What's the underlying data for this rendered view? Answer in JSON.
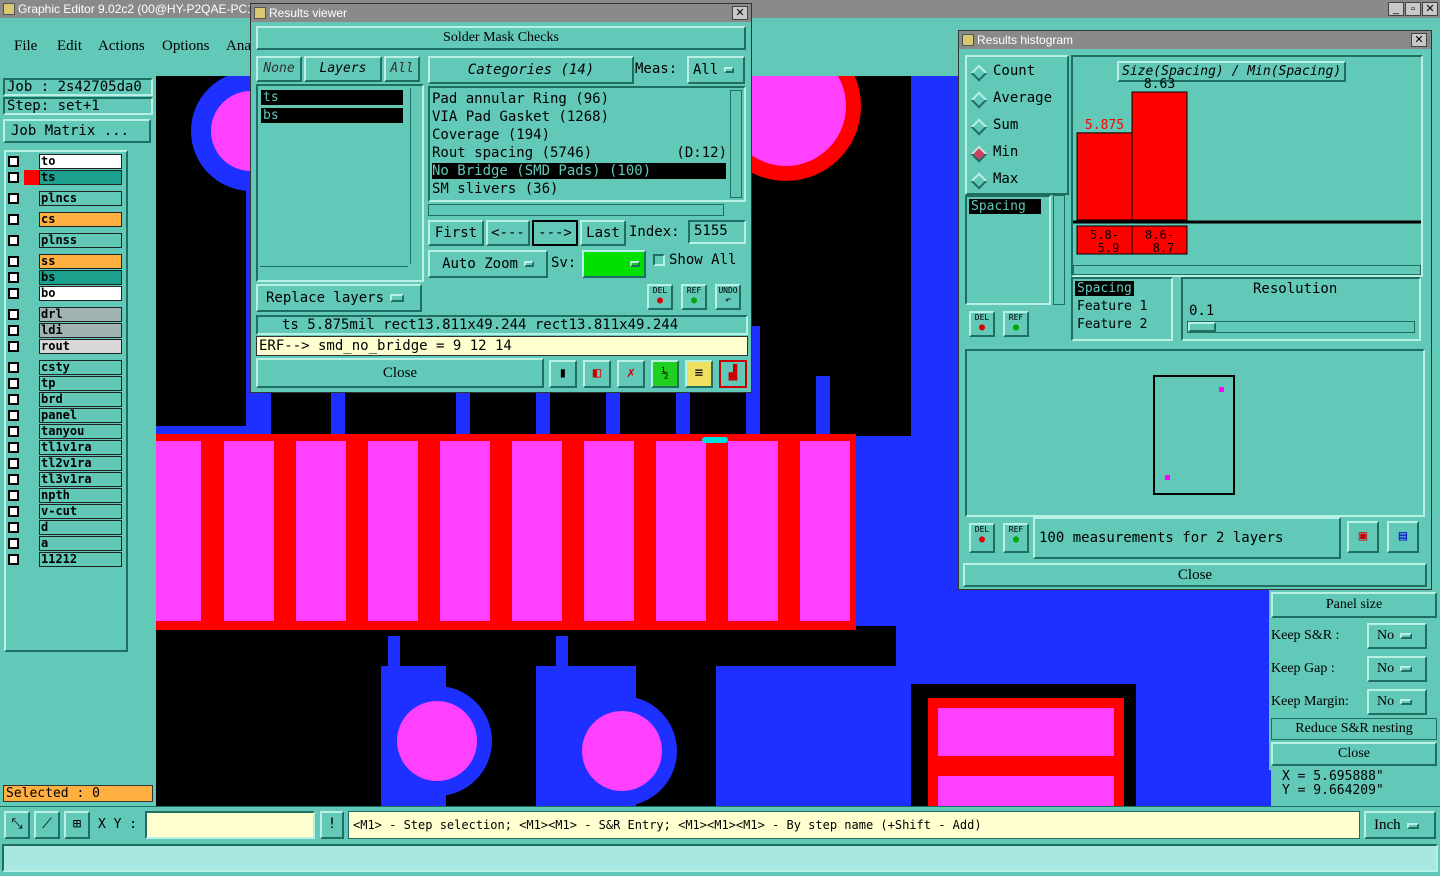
{
  "app": {
    "title": "Graphic Editor 9.02c2 (00@HY-P2QAE-PC1",
    "menu": [
      "File",
      "Edit",
      "Actions",
      "Options",
      "Ana"
    ]
  },
  "job": {
    "label": "Job : 2s42705da0",
    "step": "Step: set+1",
    "matrix_button": "Job Matrix ..."
  },
  "layers": [
    {
      "name": "to",
      "color": "#ffffff"
    },
    {
      "name": "ts",
      "color": "#1aa08c"
    },
    {
      "name": "plncs",
      "color": "#62c8b8"
    },
    {
      "name": "cs",
      "color": "#ffb040"
    },
    {
      "name": "plnss",
      "color": "#62c8b8"
    },
    {
      "name": "ss",
      "color": "#ffb040"
    },
    {
      "name": "bs",
      "color": "#1aa08c"
    },
    {
      "name": "bo",
      "color": "#ffffff"
    },
    {
      "name": "drl",
      "color": "#a0b4b4"
    },
    {
      "name": "ldi",
      "color": "#a0b4b4"
    },
    {
      "name": "rout",
      "color": "#d8d8d8"
    },
    {
      "name": "csty",
      "color": "#62c8b8"
    },
    {
      "name": "tp",
      "color": "#62c8b8"
    },
    {
      "name": "brd",
      "color": "#62c8b8"
    },
    {
      "name": "panel",
      "color": "#62c8b8"
    },
    {
      "name": "tanyou",
      "color": "#62c8b8"
    },
    {
      "name": "tl1v1ra",
      "color": "#62c8b8"
    },
    {
      "name": "tl2v1ra",
      "color": "#62c8b8"
    },
    {
      "name": "tl3v1ra",
      "color": "#62c8b8"
    },
    {
      "name": "npth",
      "color": "#62c8b8"
    },
    {
      "name": "v-cut",
      "color": "#62c8b8"
    },
    {
      "name": "d",
      "color": "#62c8b8"
    },
    {
      "name": "a",
      "color": "#62c8b8"
    },
    {
      "name": "11212",
      "color": "#62c8b8"
    }
  ],
  "selected": "Selected : 0",
  "results_viewer": {
    "title": "Results viewer",
    "header": "Solder Mask Checks",
    "none_btn": "None",
    "layers_btn": "Layers",
    "all_btn": "All",
    "layer_list": [
      "ts",
      "bs"
    ],
    "categories_btn": "Categories (14)",
    "meas_label": "Meas:",
    "meas_value": "All",
    "categories": [
      "Pad annular Ring (96)",
      "VIA Pad Gasket (1268)",
      "Coverage (194)",
      "Rout spacing (5746)          (D:12)",
      "No Bridge (SMD Pads) (100)",
      "SM slivers (36)"
    ],
    "first_btn": "First",
    "prev_btn": "<---",
    "next_btn": "--->",
    "last_btn": "Last",
    "index_label": "Index:",
    "index_value": "5155",
    "auto_zoom": "Auto Zoom",
    "sv_label": "Sv:",
    "show_all": "Show All",
    "replace_layers": "Replace layers",
    "del": "DEL",
    "ref": "REF",
    "undo": "UNDO",
    "status": "ts 5.875mil  rect13.811x49.244  rect13.811x49.244",
    "erf": "ERF--> smd_no_bridge = 9 12 14",
    "close": "Close"
  },
  "histogram": {
    "title": "Results histogram",
    "modes": [
      "Count",
      "Average",
      "Sum",
      "Min",
      "Max"
    ],
    "selected_mode": "Min",
    "chart_title": "Size(Spacing) / Min(Spacing)",
    "list_item": "Spacing",
    "feature_list": [
      "Spacing",
      "Feature 1",
      "Feature 2"
    ],
    "resolution_label": "Resolution",
    "resolution_value": "0.1",
    "measurements": "100 measurements for 2 layers",
    "close": "Close",
    "del": "DEL",
    "ref": "REF"
  },
  "chart_data": {
    "type": "bar",
    "title": "Size(Spacing) / Min(Spacing)",
    "categories": [
      "5.8-5.9",
      "8.6-8.7"
    ],
    "values": [
      5.875,
      8.63
    ],
    "value_labels": [
      "5.875",
      "8.63"
    ],
    "bin_labels": [
      [
        "5.8-",
        "5.9"
      ],
      [
        "8.6-",
        "8.7"
      ]
    ]
  },
  "panel": {
    "panel_size": "Panel size",
    "keep_sr_label": "Keep S&R  :",
    "keep_sr_value": "No",
    "keep_gap_label": "Keep Gap   :",
    "keep_gap_value": "No",
    "keep_margin_label": "Keep Margin:",
    "keep_margin_value": "No",
    "reduce": "Reduce S&R nesting",
    "close": "Close"
  },
  "coords": {
    "x": "X = 5.695888\"",
    "y": "Y = 9.664209\""
  },
  "bottom": {
    "xy_label": "X Y :",
    "xy_value": "",
    "hint": "<M1> - Step selection; <M1><M1> - S&R Entry; <M1><M1><M1> - By step name (+Shift - Add)",
    "units": "Inch"
  },
  "colors": {
    "background": "#62c8b8",
    "board_blue": "#1e30ff",
    "pad_pink": "#ff40ff",
    "mask_red": "#ff0000"
  }
}
